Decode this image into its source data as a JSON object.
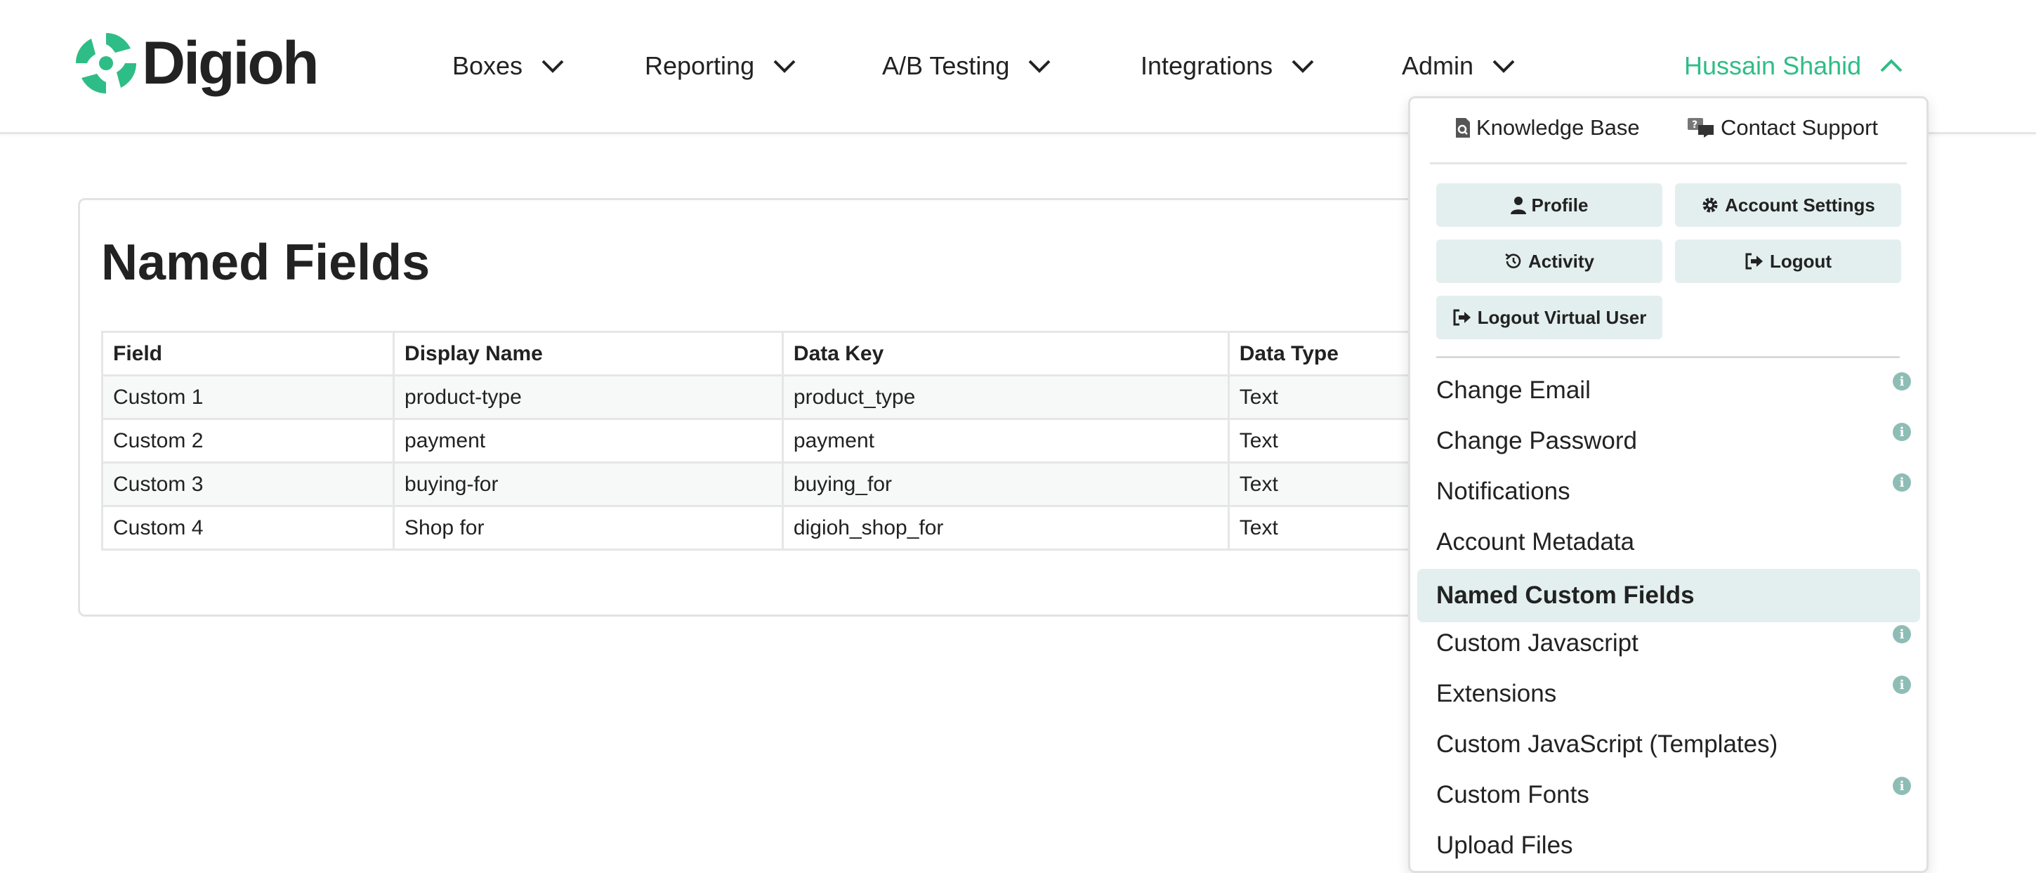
{
  "brand": {
    "name": "Digioh",
    "accent": "#2ebd86"
  },
  "nav": {
    "items": [
      "Boxes",
      "Reporting",
      "A/B Testing",
      "Integrations",
      "Admin"
    ],
    "user": "Hussain Shahid"
  },
  "page": {
    "title": "Named Fields",
    "table": {
      "headers": [
        "Field",
        "Display Name",
        "Data Key",
        "Data Type"
      ],
      "rows": [
        [
          "Custom 1",
          "product-type",
          "product_type",
          "Text"
        ],
        [
          "Custom 2",
          "payment",
          "payment",
          "Text"
        ],
        [
          "Custom 3",
          "buying-for",
          "buying_for",
          "Text"
        ],
        [
          "Custom 4",
          "Shop for",
          "digioh_shop_for",
          "Text"
        ]
      ]
    }
  },
  "dropdown": {
    "knowledge_base": "Knowledge Base",
    "contact_support": "Contact Support",
    "buttons": {
      "profile": "Profile",
      "account_settings": "Account Settings",
      "activity": "Activity",
      "logout": "Logout",
      "logout_virtual": "Logout Virtual User"
    },
    "items": [
      {
        "label": "Change Email",
        "info": true
      },
      {
        "label": "Change Password",
        "info": true
      },
      {
        "label": "Notifications",
        "info": true
      },
      {
        "label": "Account Metadata",
        "info": false
      },
      {
        "label": "Named Custom Fields",
        "info": false,
        "active": true
      },
      {
        "label": "Custom Javascript",
        "info": true
      },
      {
        "label": "Extensions",
        "info": true
      },
      {
        "label": "Custom JavaScript (Templates)",
        "info": false
      },
      {
        "label": "Custom Fonts",
        "info": true
      },
      {
        "label": "Upload Files",
        "info": false
      }
    ],
    "info_glyph": "i"
  }
}
